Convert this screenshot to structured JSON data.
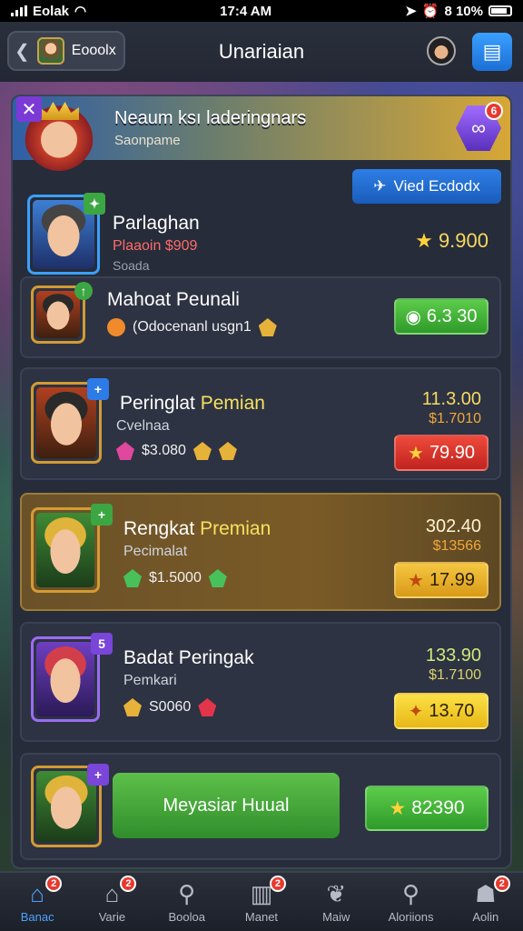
{
  "status_bar": {
    "carrier": "Eolak",
    "time": "17:4 AM",
    "battery": "8 10%"
  },
  "top_bar": {
    "back_label": "Eooolx",
    "title": "Unariaian"
  },
  "banner": {
    "title": "Neaum ksı laderingnars",
    "subtitle": "Saonpame",
    "badge": "6"
  },
  "action_button": {
    "label": "Vied Ecdodx"
  },
  "cards": [
    {
      "name": "Parlaghan",
      "line1": "Plaaoin $909",
      "line2": "Soada",
      "price": "9.900"
    },
    {
      "name": "Mahoat Peunali",
      "detail": "(Odocenanl usgn1",
      "price": "6.3 30"
    },
    {
      "name_a": "Peringlat ",
      "name_b": "Pemian",
      "sub": "Cvelnaa",
      "gems_value": "$3.080",
      "value1": "11.3.00",
      "value2": "$1.7010",
      "price": "79.90"
    },
    {
      "name_a": "Rengkat ",
      "name_b": "Premian",
      "sub": "Pecimalat",
      "gems_value": "$1.5000",
      "value1": "302.40",
      "value2": "$13566",
      "price": "17.99"
    },
    {
      "name": "Badat Peringak",
      "sub": "Pemkari",
      "gems_value": "S0060",
      "value1": "133.90",
      "value2": "$1.7100",
      "price": "13.70"
    },
    {
      "button_label": "Meyasiar Huual",
      "price": "82390"
    }
  ],
  "nav": [
    {
      "label": "Banac",
      "badge": "2",
      "icon": "home-icon"
    },
    {
      "label": "Varie",
      "badge": "2",
      "icon": "house-icon"
    },
    {
      "label": "Booloa",
      "badge": "",
      "icon": "search-icon"
    },
    {
      "label": "Manet",
      "badge": "2",
      "icon": "market-icon"
    },
    {
      "label": "Maiw",
      "badge": "",
      "icon": "leaf-icon"
    },
    {
      "label": "Aloriions",
      "badge": "",
      "icon": "magnifier-icon"
    },
    {
      "label": "Aolin",
      "badge": "2",
      "icon": "profile-icon"
    }
  ],
  "colors": {
    "accent_blue": "#2e7ee6",
    "green": "#3ca643",
    "red": "#e63a2f",
    "gold": "#f5c742"
  }
}
